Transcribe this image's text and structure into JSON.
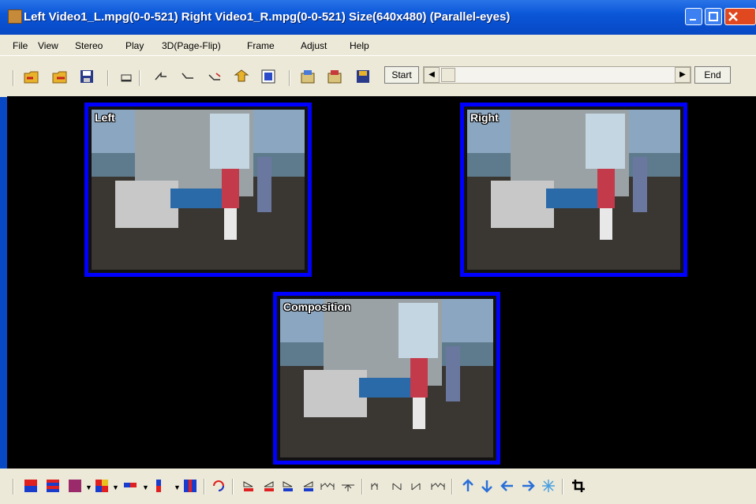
{
  "window": {
    "title": "Left Video1_L.mpg(0-0-521) Right Video1_R.mpg(0-0-521) Size(640x480)  (Parallel-eyes)"
  },
  "menu": {
    "file": "File",
    "view": "View",
    "stereo": "Stereo",
    "play": "Play",
    "page_flip": "3D(Page-Flip)",
    "frame": "Frame",
    "adjust": "Adjust",
    "help": "Help"
  },
  "toolbar": {
    "start_label": "Start",
    "end_label": "End",
    "icons": [
      "open-left-icon",
      "open-right-icon",
      "save-icon",
      "capture-icon",
      "step-back-icon",
      "step-icon",
      "step-forward-icon",
      "swap-icon",
      "fullscreen-icon",
      "export-icon",
      "export-image-icon",
      "save-stereo-icon"
    ],
    "scroll_position": 0.0
  },
  "views": {
    "left_label": "Left",
    "right_label": "Right",
    "composition_label": "Composition"
  },
  "bottom_toolbar": {
    "icons": [
      "anaglyph-red-blue-icon",
      "interlaced-icon",
      "checkerboard-icon",
      "color-checker-icon",
      "side-by-side-icon",
      "over-under-icon",
      "single-mode-icon",
      "swap-eyes-icon",
      "align-1-icon",
      "align-2-icon",
      "align-3-icon",
      "align-4-icon",
      "stretch-icon",
      "shrink-icon",
      "shift-1-icon",
      "shift-2-icon",
      "shift-3-icon",
      "shift-4-icon",
      "arrow-up-icon",
      "arrow-down-icon",
      "arrow-left-icon",
      "arrow-right-icon",
      "auto-align-icon",
      "crop-icon"
    ],
    "colors": {
      "red": "#e02020",
      "blue": "#1a3ccc",
      "arrow_blue": "#2a6fd8"
    }
  }
}
